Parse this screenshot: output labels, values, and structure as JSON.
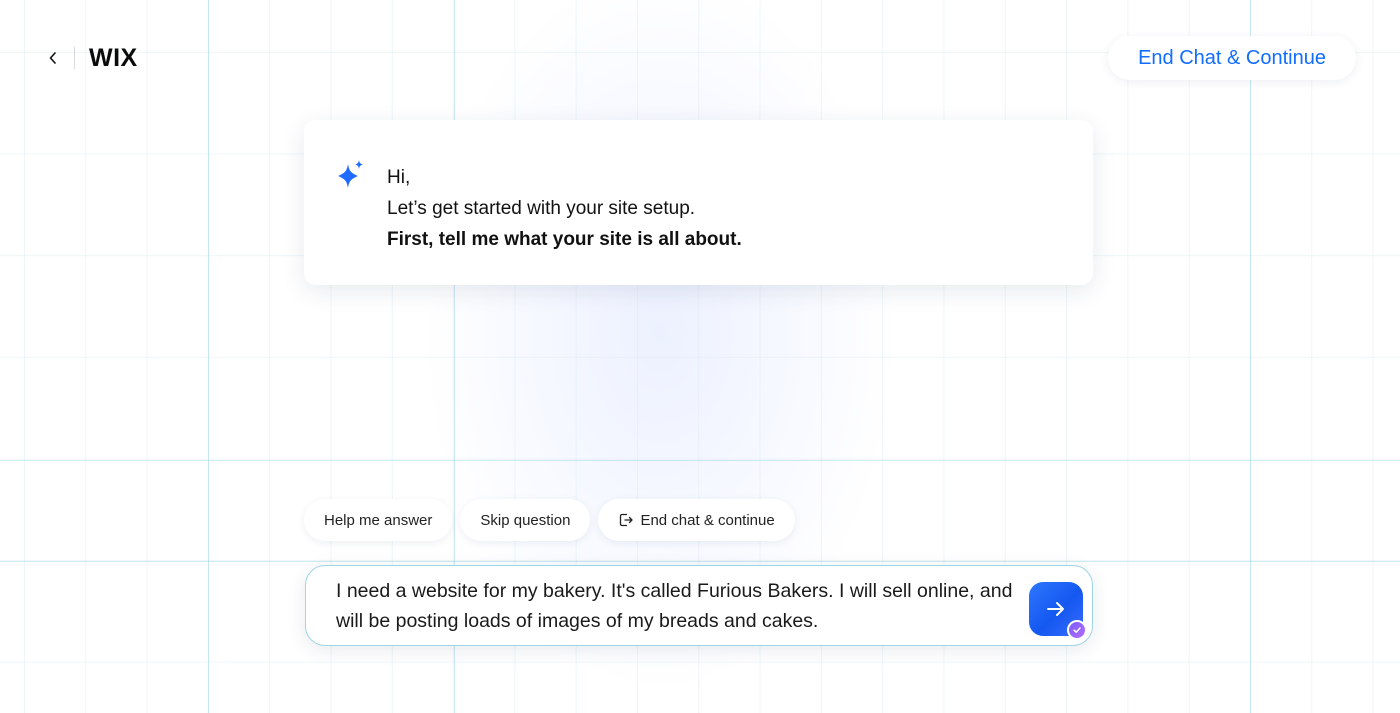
{
  "header": {
    "back_icon": "chevron-left-icon",
    "logo": "WIX",
    "end_chat_label": "End Chat & Continue"
  },
  "message": {
    "icon": "sparkle-icon",
    "greeting": "Hi,",
    "line2": "Let’s get started with your site setup.",
    "line3": "First, tell me what your site is all about."
  },
  "suggestions": [
    {
      "label": "Help me answer"
    },
    {
      "label": "Skip question"
    },
    {
      "label": "End chat & continue",
      "icon": "exit-icon"
    }
  ],
  "input": {
    "value": "I need a website for my bakery. It's called Furious Bakers. I will sell online, and will be posting loads of images of my breads and cakes.",
    "send_icon": "arrow-right-icon"
  },
  "colors": {
    "accent": "#116dff",
    "sparkle": "#1f6bff"
  }
}
